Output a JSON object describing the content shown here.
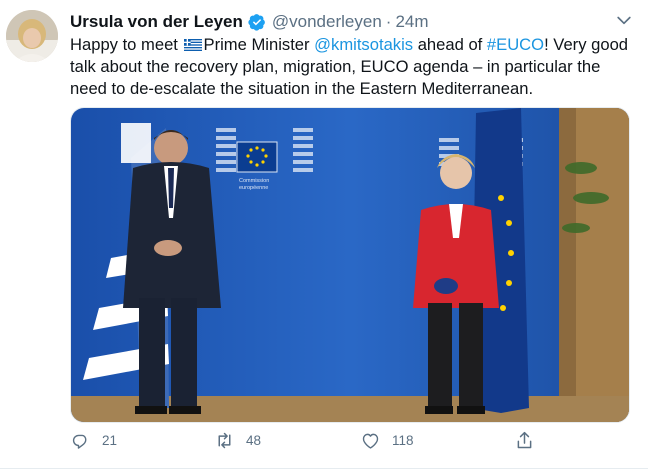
{
  "tweet": {
    "author_name": "Ursula von der Leyen",
    "handle": "@vonderleyen",
    "separator": "·",
    "time": "24m",
    "text": {
      "part1": "Happy to meet ",
      "part2": "Prime Minister ",
      "mention": "@kmitsotakis",
      "part3": " ahead of ",
      "hashtag": "#EUCO",
      "part4": "! Very good talk about the recovery plan, migration, EUCO agenda – in particular the need to de-escalate the situation in the Eastern Mediterranean."
    },
    "media_sign_text": [
      "Commission",
      "européenne"
    ],
    "counts": {
      "replies": "21",
      "retweets": "48",
      "likes": "118"
    }
  },
  "colors": {
    "link": "#1b95e0",
    "secondary_text": "#5b7083",
    "verified": "#1da1f2",
    "eu_blue": "#1f4fa8",
    "eu_yellow": "#ffd200",
    "jacket_red": "#d8262f"
  },
  "icons": [
    "verified-badge-icon",
    "chevron-down-icon",
    "greek-flag-icon",
    "reply-icon",
    "retweet-icon",
    "like-icon",
    "share-icon"
  ]
}
